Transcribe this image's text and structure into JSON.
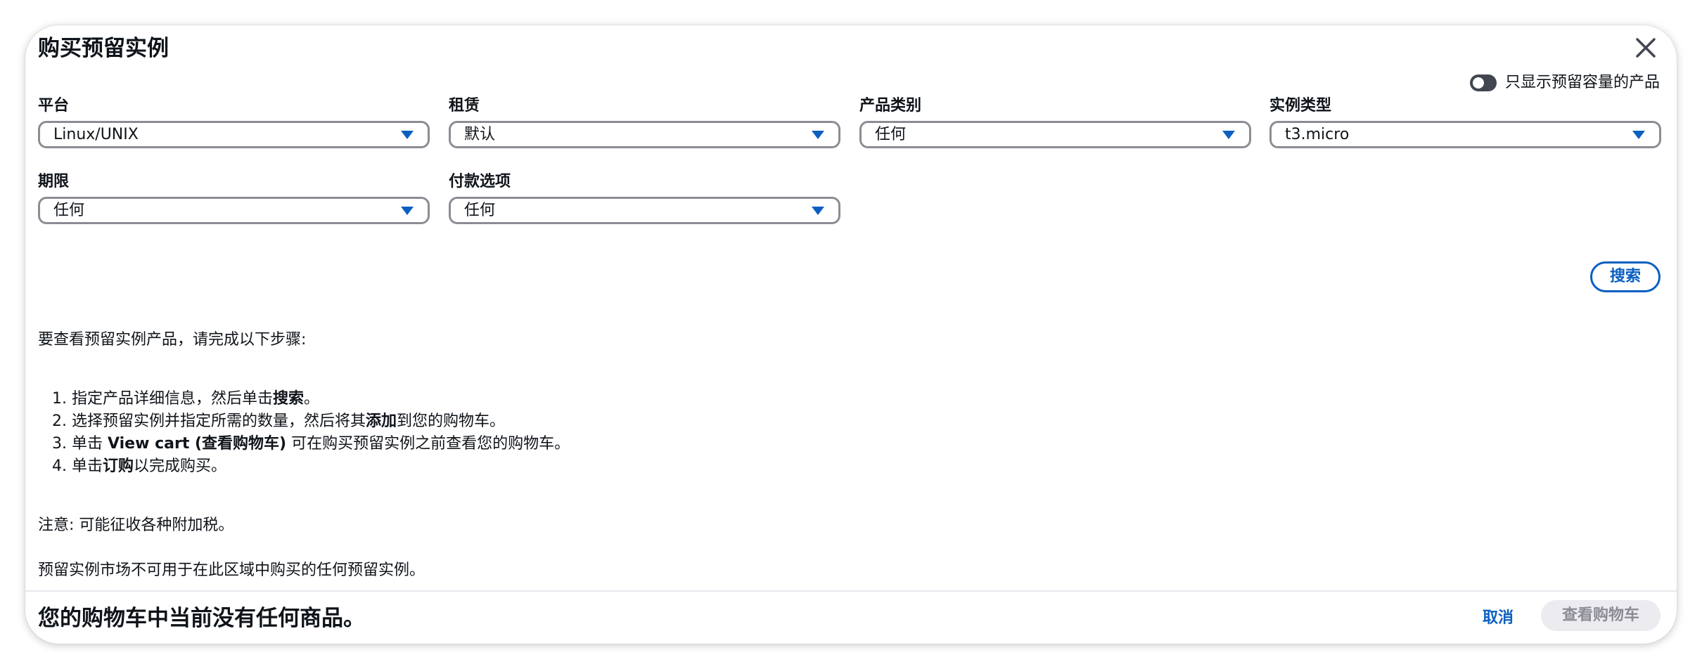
{
  "dialog": {
    "title": "购买预留实例",
    "toggle_label": "只显示预留容量的产品",
    "toggle_on": false
  },
  "filters": [
    {
      "label": "平台",
      "value": "Linux/UNIX"
    },
    {
      "label": "租赁",
      "value": "默认"
    },
    {
      "label": "产品类别",
      "value": "任何"
    },
    {
      "label": "实例类型",
      "value": "t3.micro"
    },
    {
      "label": "期限",
      "value": "任何"
    },
    {
      "label": "付款选项",
      "value": "任何"
    }
  ],
  "search_label": "搜索",
  "instructions": {
    "intro": "要查看预留实例产品，请完成以下步骤:",
    "steps": [
      {
        "num": "1.",
        "before": "指定产品详细信息，然后单击",
        "bold": "搜索",
        "after": "。"
      },
      {
        "num": "2.",
        "before": "选择预留实例并指定所需的数量，然后将其",
        "bold": "添加",
        "after": "到您的购物车。"
      },
      {
        "num": "3.",
        "before": "单击 ",
        "bold": "View cart (查看购物车)",
        "after": " 可在购买预留实例之前查看您的购物车。"
      },
      {
        "num": "4.",
        "before": "单击",
        "bold": "订购",
        "after": "以完成购买。"
      }
    ],
    "note": "注意: 可能征收各种附加税。",
    "marketplace_note": "预留实例市场不可用于在此区域中购买的任何预留实例。"
  },
  "footer": {
    "message": "您的购物车中当前没有任何商品。",
    "cancel_label": "取消",
    "view_cart_label": "查看购物车"
  },
  "colors": {
    "accent": "#0a5fc1",
    "border": "#8c8c94",
    "disabled_bg": "#ebebf0",
    "disabled_text": "#8c8c94"
  }
}
